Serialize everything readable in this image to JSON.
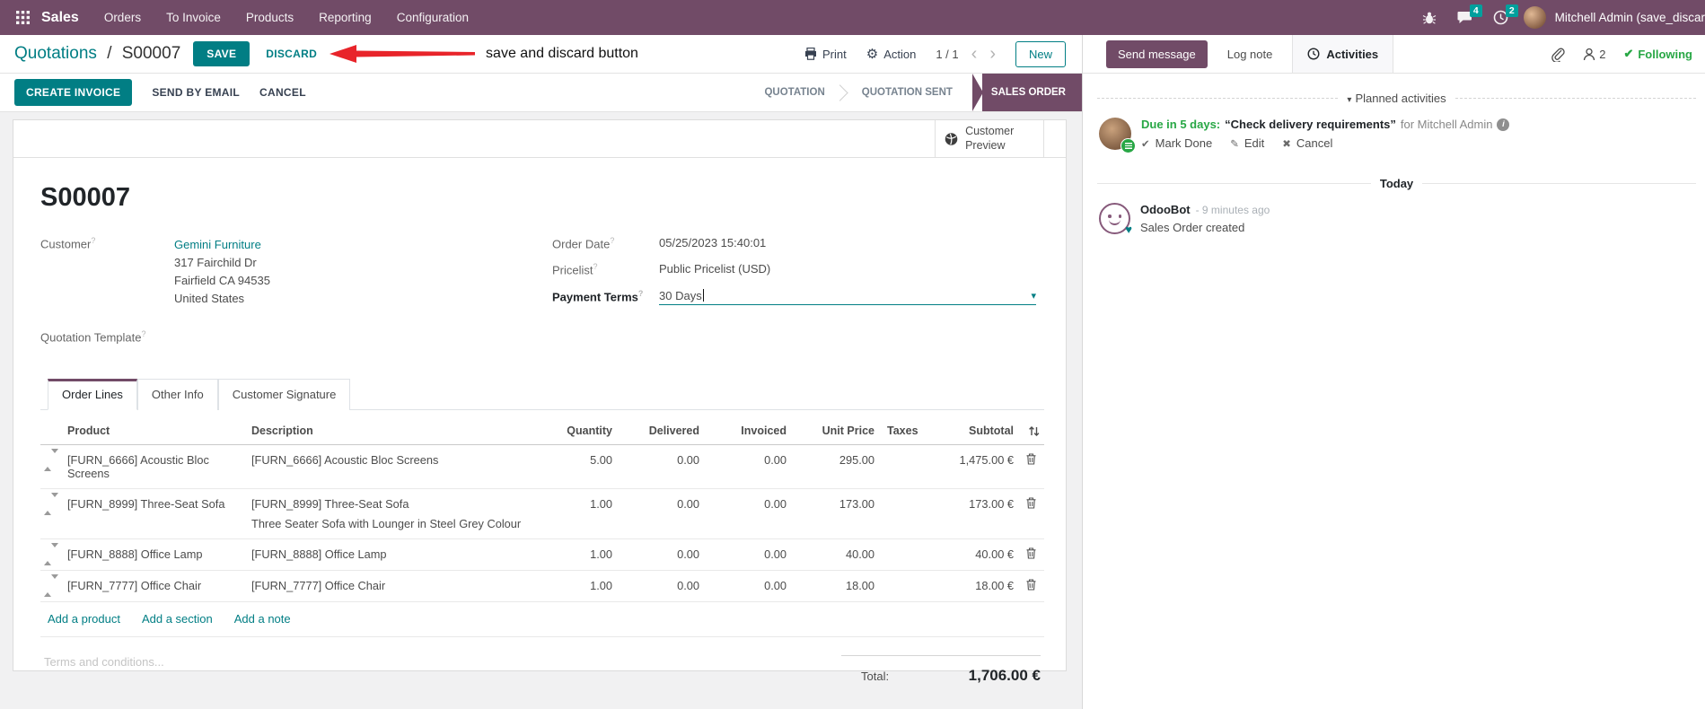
{
  "icons": {
    "caret_down": "▾",
    "gear": "⚙",
    "chev_left": "‹",
    "chev_right": "›",
    "check": "✔",
    "edit_pencil": "✎",
    "x_mark": "✖",
    "heart": "♥"
  },
  "colors": {
    "brand_purple": "#714B67",
    "accent_teal": "#017E84",
    "modified_blue": "#17A2B8",
    "success_green": "#28A745"
  },
  "topnav": {
    "app_name": "Sales",
    "menus": [
      "Orders",
      "To Invoice",
      "Products",
      "Reporting",
      "Configuration"
    ],
    "messages_badge": "4",
    "activities_badge": "2",
    "user_name": "Mitchell Admin (save_discar"
  },
  "breadcrumb": {
    "parent": "Quotations",
    "separator": "/",
    "current": "S00007",
    "save": "SAVE",
    "discard": "DISCARD",
    "annotation": "save and discard button",
    "print": "Print",
    "action": "Action",
    "pager": "1 / 1",
    "new": "New"
  },
  "statusbar": {
    "create_invoice": "CREATE INVOICE",
    "send_by_email": "SEND BY EMAIL",
    "cancel": "CANCEL",
    "stages": [
      {
        "label": "QUOTATION",
        "active": false
      },
      {
        "label": "QUOTATION SENT",
        "active": false
      },
      {
        "label": "SALES ORDER",
        "active": true
      }
    ]
  },
  "form": {
    "preview_button": "Customer Preview",
    "help": "?",
    "title": "S00007",
    "customer_label": "Customer",
    "customer_name": "Gemini Furniture",
    "address_line1": "317 Fairchild Dr",
    "address_line2": "Fairfield CA 94535",
    "address_line3": "United States",
    "quotation_template_label": "Quotation Template",
    "order_date_label": "Order Date",
    "order_date": "05/25/2023 15:40:01",
    "pricelist_label": "Pricelist",
    "pricelist": "Public Pricelist (USD)",
    "payment_terms_label": "Payment Terms",
    "payment_terms": "30 Days",
    "tabs": [
      "Order Lines",
      "Other Info",
      "Customer Signature"
    ],
    "table": {
      "headers": [
        "Product",
        "Description",
        "Quantity",
        "Delivered",
        "Invoiced",
        "Unit Price",
        "Taxes",
        "Subtotal"
      ],
      "rows": [
        {
          "product": "[FURN_6666] Acoustic Bloc Screens",
          "description": "[FURN_6666] Acoustic Bloc Screens",
          "description2": "",
          "quantity": "5.00",
          "delivered": "0.00",
          "invoiced": "0.00",
          "unit_price": "295.00",
          "taxes": "",
          "subtotal": "1,475.00 €"
        },
        {
          "product": "[FURN_8999] Three-Seat Sofa",
          "description": "[FURN_8999] Three-Seat Sofa",
          "description2": "Three Seater Sofa with Lounger in Steel Grey Colour",
          "quantity": "1.00",
          "delivered": "0.00",
          "invoiced": "0.00",
          "unit_price": "173.00",
          "taxes": "",
          "subtotal": "173.00 €"
        },
        {
          "product": "[FURN_8888] Office Lamp",
          "description": "[FURN_8888] Office Lamp",
          "description2": "",
          "quantity": "1.00",
          "delivered": "0.00",
          "invoiced": "0.00",
          "unit_price": "40.00",
          "taxes": "",
          "subtotal": "40.00 €"
        },
        {
          "product": "[FURN_7777] Office Chair",
          "description": "[FURN_7777] Office Chair",
          "description2": "",
          "quantity": "1.00",
          "delivered": "0.00",
          "invoiced": "0.00",
          "unit_price": "18.00",
          "taxes": "",
          "subtotal": "18.00 €"
        }
      ],
      "add_product": "Add a product",
      "add_section": "Add a section",
      "add_note": "Add a note"
    },
    "terms_placeholder": "Terms and conditions...",
    "total_label": "Total:",
    "total_value": "1,706.00 €"
  },
  "chatter": {
    "send_message": "Send message",
    "log_note": "Log note",
    "activities_tab": "Activities",
    "followers_count": "2",
    "following": "Following",
    "planned_title": "Planned activities",
    "activity_due": "Due in 5 days:",
    "activity_summary": "“Check delivery requirements”",
    "activity_for": "for Mitchell Admin",
    "mark_done": "Mark Done",
    "edit": "Edit",
    "cancel": "Cancel",
    "today": "Today",
    "bot_name": "OdooBot",
    "bot_time": "- 9 minutes ago",
    "bot_message": "Sales Order created"
  }
}
